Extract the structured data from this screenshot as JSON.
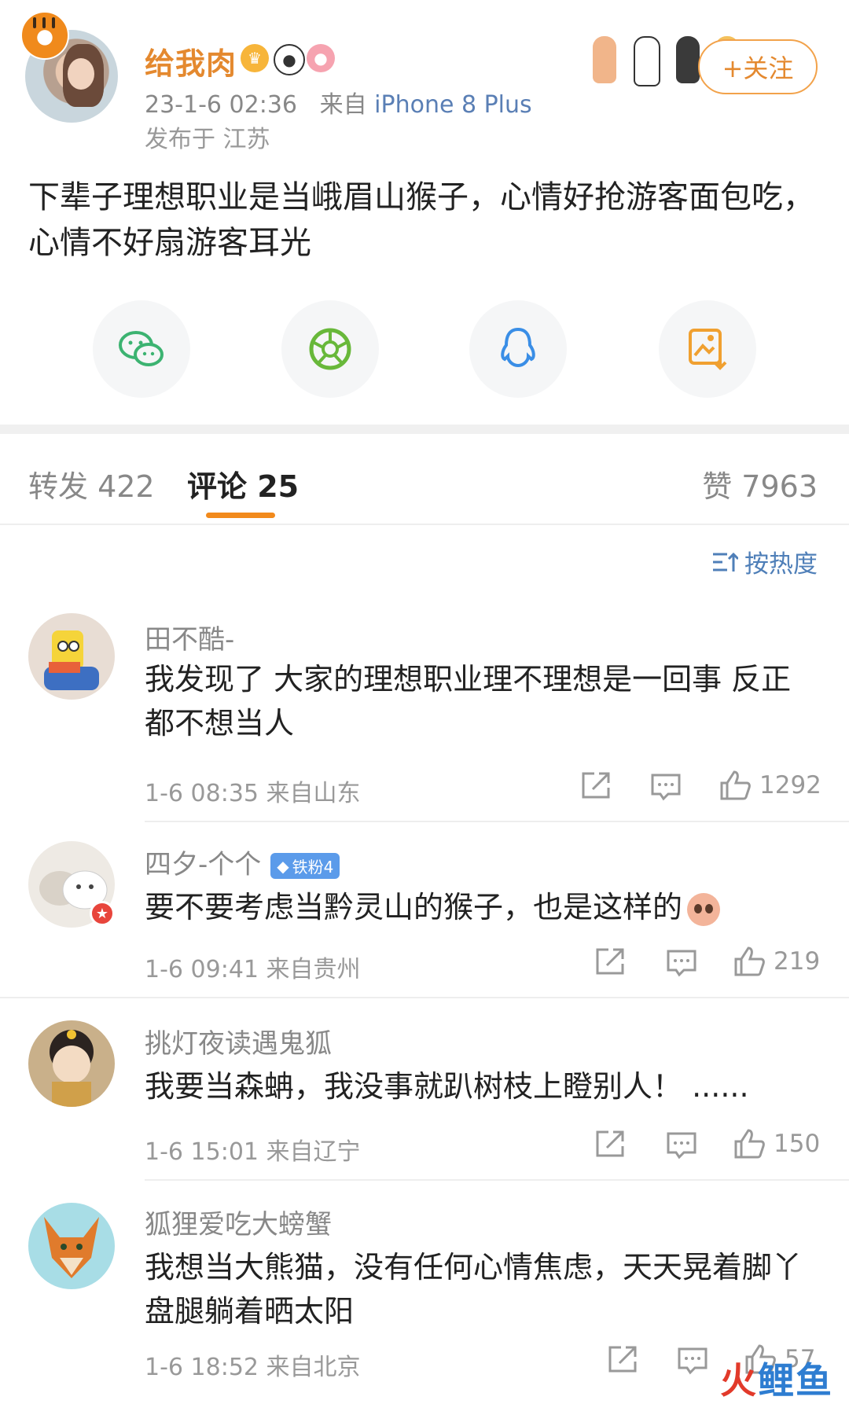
{
  "post": {
    "username": "给我肉",
    "timestamp": "23-1-6 02:36",
    "source_prefix": "来自",
    "device": "iPhone 8 Plus",
    "location": "发布于 江苏",
    "follow_label": "+关注",
    "text": "下辈子理想职业是当峨眉山猴子，心情好抢游客面包吃，心情不好扇游客耳光",
    "badges": [
      "crown-icon",
      "panda-icon",
      "pig-icon"
    ]
  },
  "share": {
    "items": [
      "wechat-icon",
      "moments-icon",
      "qq-icon",
      "save-image-icon"
    ]
  },
  "tabs": {
    "repost": "转发 422",
    "comments": "评论 25",
    "likes": "赞 7963"
  },
  "sort": {
    "label": "按热度"
  },
  "comments": [
    {
      "name": "田不酷-",
      "text": "我发现了 大家的理想职业理不理想是一回事 反正都不想当人",
      "time": "1-6 08:35 来自山东",
      "likes": "1292"
    },
    {
      "name": "四夕-个个",
      "badge": "铁粉4",
      "text": "要不要考虑当黔灵山的猴子，也是这样的",
      "time": "1-6 09:41 来自贵州",
      "likes": "219"
    },
    {
      "name": "挑灯夜读遇鬼狐",
      "text": "我要当森蚺，我没事就趴树枝上瞪别人！ ......",
      "time": "1-6 15:01 来自辽宁",
      "likes": "150"
    },
    {
      "name": "狐狸爱吃大螃蟹",
      "text": "我想当大熊猫，没有任何心情焦虑，天天晃着脚丫盘腿躺着晒太阳",
      "time": "1-6 18:52 来自北京",
      "likes": "57"
    }
  ],
  "watermark": {
    "part1": "火",
    "part2": "鲤鱼"
  },
  "colors": {
    "accent": "#e4892f",
    "link": "#5a7fb5",
    "tab_underline": "#f28a1c"
  }
}
